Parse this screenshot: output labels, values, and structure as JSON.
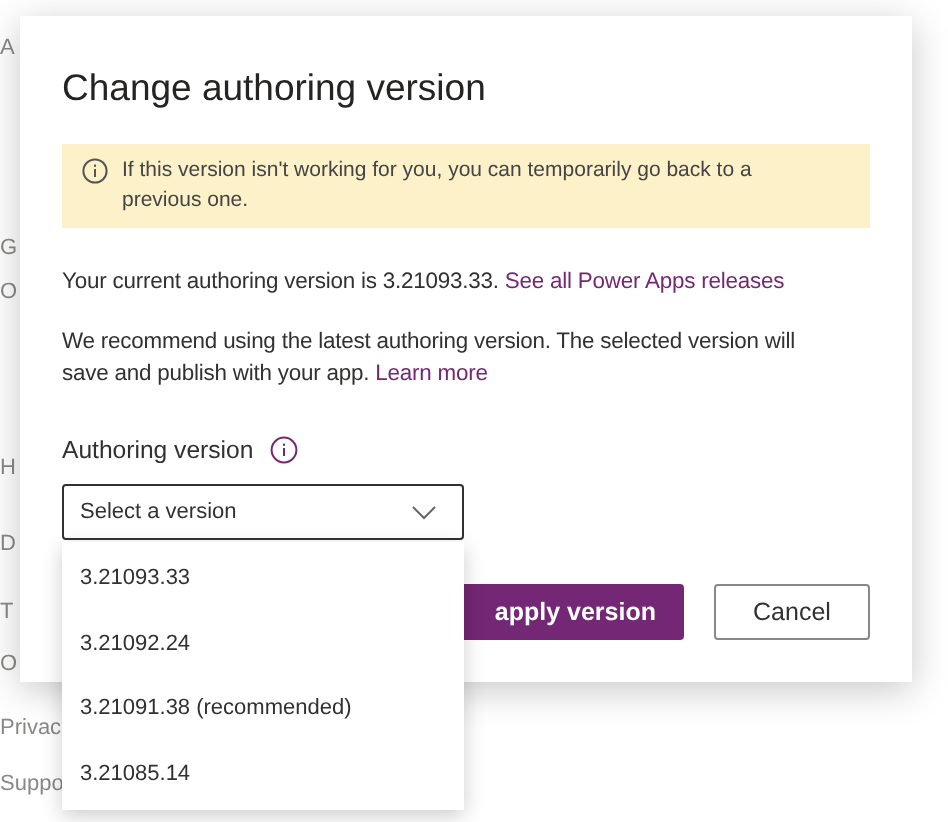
{
  "background_page": {
    "items": [
      "A",
      "G",
      "O",
      "H",
      "D",
      "T",
      "O",
      "Privac",
      "Suppo"
    ]
  },
  "dialog": {
    "title": "Change authoring version",
    "notice": "If this version isn't working for you, you can temporarily go back to a previous one.",
    "current_version": {
      "text": "Your current authoring version is 3.21093.33.",
      "link": "See all Power Apps releases"
    },
    "recommendation": {
      "text": "We recommend using the latest authoring version. The selected version will save and publish with your app.",
      "link": "Learn more"
    },
    "field": {
      "label": "Authoring version",
      "placeholder": "Select a version",
      "expanded": true,
      "options": [
        "3.21093.33",
        "3.21092.24",
        "3.21091.38 (recommended)",
        "3.21085.14"
      ]
    },
    "buttons": [
      {
        "label": "apply version",
        "kind": "primary"
      },
      {
        "label": "Cancel",
        "kind": "secondary"
      }
    ]
  }
}
